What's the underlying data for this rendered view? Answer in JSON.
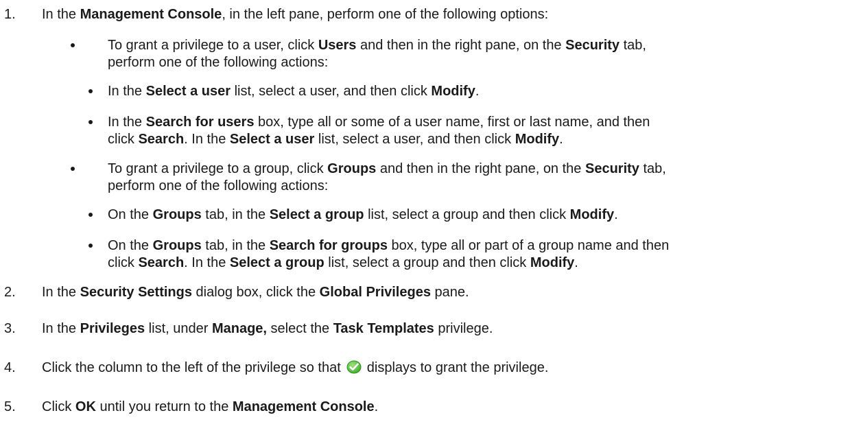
{
  "steps": [
    {
      "number": "1.",
      "text": [
        {
          "t": "In the "
        },
        {
          "b": "Management Console"
        },
        {
          "t": ", in the left pane, perform one of the following options:"
        }
      ]
    },
    {
      "number": "2.",
      "text": [
        {
          "t": "In the "
        },
        {
          "b": "Security Settings"
        },
        {
          "t": " dialog box, click the "
        },
        {
          "b": "Global Privileges"
        },
        {
          "t": " pane."
        }
      ]
    },
    {
      "number": "3.",
      "text": [
        {
          "t": "In the "
        },
        {
          "b": "Privileges"
        },
        {
          "t": " list, under "
        },
        {
          "b": "Manage,"
        },
        {
          "t": " select the "
        },
        {
          "b": "Task Templates"
        },
        {
          "t": " privilege."
        }
      ]
    },
    {
      "number": "4.",
      "text": [
        {
          "t": "Click the column to the left of the privilege so that"
        },
        {
          "icon": "check-icon"
        },
        {
          "t": "displays to grant the privilege."
        }
      ]
    },
    {
      "number": "5.",
      "text": [
        {
          "t": "Click "
        },
        {
          "b": "OK"
        },
        {
          "t": " until you return to the "
        },
        {
          "b": "Management Console"
        },
        {
          "t": "."
        }
      ]
    }
  ],
  "options": [
    {
      "lines": [
        [
          {
            "t": "To grant a privilege to a user, click "
          },
          {
            "b": "Users"
          },
          {
            "t": " and then in the right pane, on the "
          },
          {
            "b": "Security"
          },
          {
            "t": " tab,"
          }
        ],
        [
          {
            "t": "perform one of the following actions:"
          }
        ]
      ],
      "actions": [
        {
          "lines": [
            [
              {
                "t": "In the "
              },
              {
                "b": "Select a user"
              },
              {
                "t": " list, select a user, and then click "
              },
              {
                "b": "Modify"
              },
              {
                "t": "."
              }
            ]
          ]
        },
        {
          "lines": [
            [
              {
                "t": "In the "
              },
              {
                "b": "Search for users"
              },
              {
                "t": " box, type all or some of a user name, first or last name, and then"
              }
            ],
            [
              {
                "t": "click "
              },
              {
                "b": "Search"
              },
              {
                "t": ". In the "
              },
              {
                "b": "Select a user"
              },
              {
                "t": " list, select a user, and then click "
              },
              {
                "b": "Modify"
              },
              {
                "t": "."
              }
            ]
          ]
        }
      ]
    },
    {
      "lines": [
        [
          {
            "t": "To grant a privilege to a group, click "
          },
          {
            "b": "Groups"
          },
          {
            "t": " and then in the right pane, on the "
          },
          {
            "b": "Security"
          },
          {
            "t": " tab,"
          }
        ],
        [
          {
            "t": "perform one of the following actions:"
          }
        ]
      ],
      "actions": [
        {
          "lines": [
            [
              {
                "t": "On the "
              },
              {
                "b": "Groups"
              },
              {
                "t": " tab, in the "
              },
              {
                "b": "Select a group"
              },
              {
                "t": " list, select a group and then click "
              },
              {
                "b": "Modify"
              },
              {
                "t": "."
              }
            ]
          ]
        },
        {
          "lines": [
            [
              {
                "t": "On the "
              },
              {
                "b": "Groups"
              },
              {
                "t": " tab, in the "
              },
              {
                "b": "Search for groups"
              },
              {
                "t": " box, type all or part of a group name and then"
              }
            ],
            [
              {
                "t": "click "
              },
              {
                "b": "Search"
              },
              {
                "t": ". In the "
              },
              {
                "b": "Select a group"
              },
              {
                "t": " list, select a group and then click "
              },
              {
                "b": "Modify"
              },
              {
                "t": "."
              }
            ]
          ]
        }
      ]
    }
  ],
  "colors": {
    "text": "#1a1a1a",
    "check_green": "#3fae2a"
  }
}
